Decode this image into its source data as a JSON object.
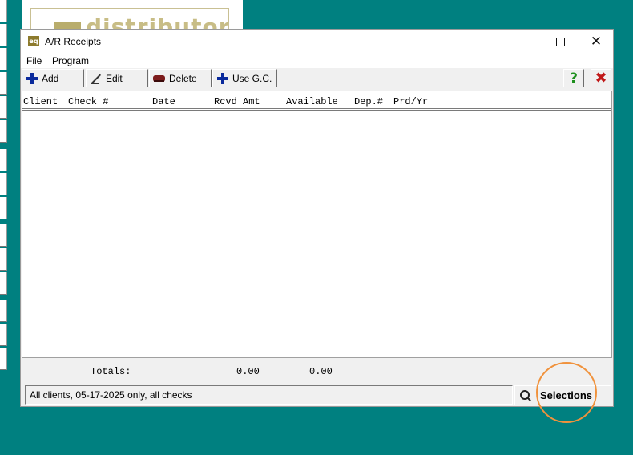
{
  "background_app": {
    "logo_text": "distributor"
  },
  "window": {
    "title": "A/R Receipts",
    "app_icon_text": "eq",
    "controls": {
      "minimize": "minimize-icon",
      "maximize": "maximize-icon",
      "close": "close-icon"
    }
  },
  "menu": {
    "items": [
      "File",
      "Program"
    ]
  },
  "toolbar": {
    "add_label": "Add",
    "edit_label": "Edit",
    "delete_label": "Delete",
    "use_gc_label": "Use G.C.",
    "help_symbol": "?",
    "exit_symbol": "✖"
  },
  "grid": {
    "columns": [
      "Client",
      "Check #",
      "Date",
      "Rcvd Amt",
      "Available",
      "Dep.#",
      "Prd/Yr"
    ],
    "rows": []
  },
  "totals": {
    "label": "Totals:",
    "rcvd_amt": "0.00",
    "available": "0.00"
  },
  "status": {
    "text": "All clients, 05-17-2025 only, all checks"
  },
  "selections_button": {
    "label": "Selections"
  },
  "colors": {
    "desktop": "#008080",
    "highlight_ring": "#f0923c",
    "add_icon": "#0a2a9c",
    "help": "#1d8f1d",
    "exit": "#c01818"
  }
}
